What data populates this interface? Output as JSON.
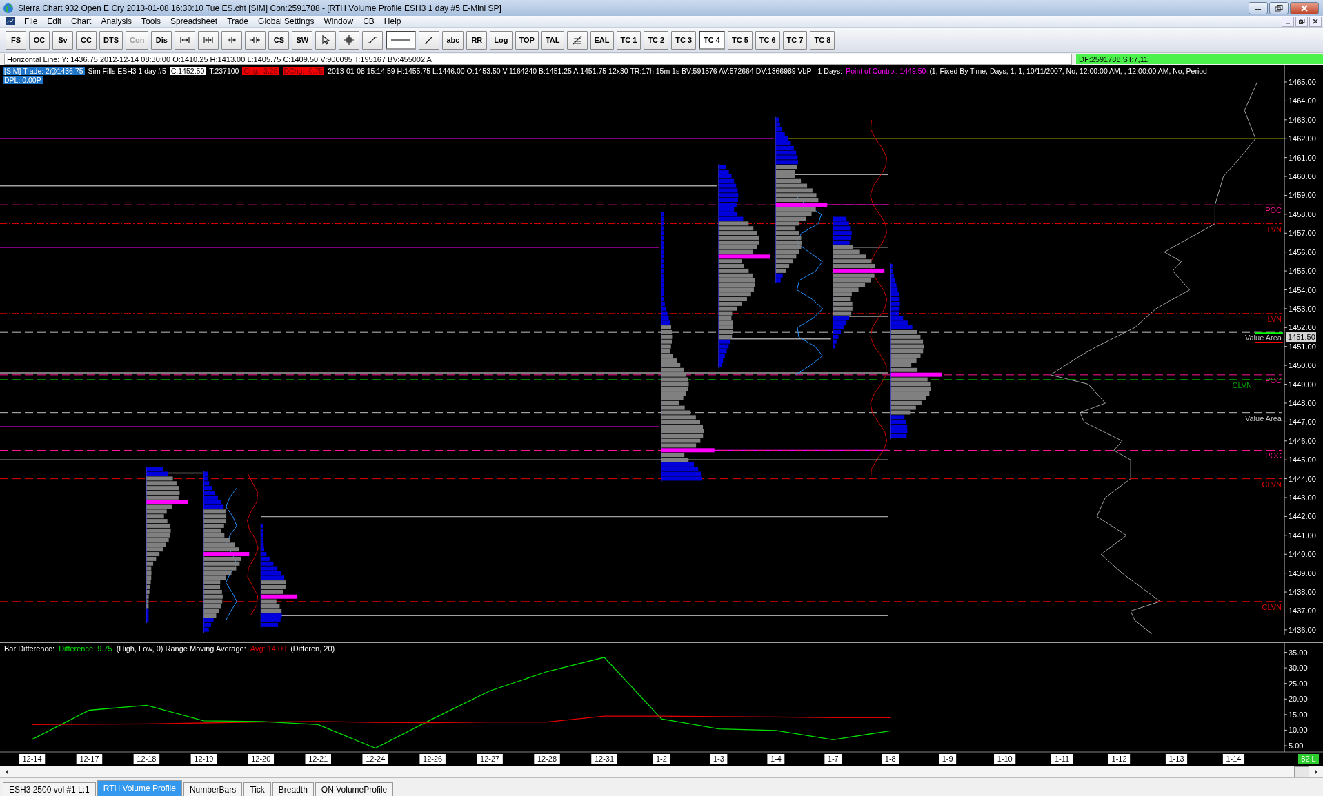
{
  "window": {
    "title": "Sierra Chart 932 Open E Cry 2013-01-08  16:30:10 Tue  ES.cht [SIM] Con:2591788 - [RTH Volume Profile  ESH3  1 day  #5  E-Mini SP]"
  },
  "menu": [
    "File",
    "Edit",
    "Chart",
    "Analysis",
    "Tools",
    "Spreadsheet",
    "Trade",
    "Global Settings",
    "Window",
    "CB",
    "Help"
  ],
  "toolbar": [
    {
      "kind": "text",
      "label": "FS",
      "selected": false,
      "disabled": false
    },
    {
      "kind": "text",
      "label": "OC",
      "selected": false,
      "disabled": false
    },
    {
      "kind": "text",
      "label": "Sv",
      "selected": false,
      "disabled": false
    },
    {
      "kind": "text",
      "label": "CC",
      "selected": false,
      "disabled": false
    },
    {
      "kind": "text",
      "label": "DTS",
      "selected": false,
      "disabled": false
    },
    {
      "kind": "text",
      "label": "Con",
      "selected": false,
      "disabled": true
    },
    {
      "kind": "text",
      "label": "Dis",
      "selected": false,
      "disabled": false
    },
    {
      "kind": "icon",
      "selected": false,
      "disabled": false
    },
    {
      "kind": "icon",
      "selected": false,
      "disabled": false
    },
    {
      "kind": "icon",
      "selected": false,
      "disabled": false
    },
    {
      "kind": "icon",
      "selected": false,
      "disabled": false
    },
    {
      "kind": "text",
      "label": "CS",
      "selected": false,
      "disabled": false
    },
    {
      "kind": "text",
      "label": "SW",
      "selected": false,
      "disabled": false
    },
    {
      "kind": "icon",
      "selected": false,
      "disabled": false
    },
    {
      "kind": "icon",
      "selected": false,
      "disabled": false
    },
    {
      "kind": "icon",
      "selected": false,
      "disabled": false
    },
    {
      "kind": "icon",
      "selected": true,
      "disabled": false
    },
    {
      "kind": "icon",
      "selected": false,
      "disabled": false
    },
    {
      "kind": "text",
      "label": "abc",
      "selected": false,
      "disabled": false
    },
    {
      "kind": "text",
      "label": "RR",
      "selected": false,
      "disabled": false
    },
    {
      "kind": "text",
      "label": "Log",
      "selected": false,
      "disabled": false
    },
    {
      "kind": "text",
      "label": "TOP",
      "selected": false,
      "disabled": false
    },
    {
      "kind": "text",
      "label": "TAL",
      "selected": false,
      "disabled": false
    },
    {
      "kind": "icon",
      "selected": false,
      "disabled": false
    },
    {
      "kind": "text",
      "label": "EAL",
      "selected": false,
      "disabled": false
    },
    {
      "kind": "text",
      "label": "TC 1",
      "selected": false,
      "disabled": false
    },
    {
      "kind": "text",
      "label": "TC 2",
      "selected": false,
      "disabled": false
    },
    {
      "kind": "text",
      "label": "TC 3",
      "selected": false,
      "disabled": false
    },
    {
      "kind": "text",
      "label": "TC 4",
      "selected": true,
      "disabled": false
    },
    {
      "kind": "text",
      "label": "TC 5",
      "selected": false,
      "disabled": false
    },
    {
      "kind": "text",
      "label": "TC 6",
      "selected": false,
      "disabled": false
    },
    {
      "kind": "text",
      "label": "TC 7",
      "selected": false,
      "disabled": false
    },
    {
      "kind": "text",
      "label": "TC 8",
      "selected": false,
      "disabled": false
    }
  ],
  "info_bar": {
    "text": "Horizontal Line: Y: 1436.75  2012-12-14  08:30:00  O:1410.25  H:1413.00  L:1405.75  C:1409.50  V:900095  T:195167  BV:455002  A",
    "status": "DF:2591788  ST:7,11"
  },
  "chart_header": [
    [
      {
        "kind": "blue",
        "text": "[SIM]  Trade: 2@1436.75"
      },
      {
        "kind": "plain",
        "text": "Sim Fills  ESH3  1 day  #5"
      },
      {
        "kind": "box",
        "text": "C:1452.50"
      },
      {
        "kind": "plain",
        "text": "T:237100"
      },
      {
        "kind": "red",
        "text": "Chg: -3.25"
      },
      {
        "kind": "red",
        "text": "DChg: -0.75"
      },
      {
        "kind": "plain",
        "text": "2013-01-08 15:14:59 H:1455.75 L:1446.00 O:1453.50 V:1164240 B:1451.25 A:1451.75 12x30 TR:17h 15m 1s BV:591576 AV:572664 DV:1366989  VbP - 1 Days:"
      },
      {
        "kind": "magenta",
        "text": "Point of Control: 1449.50"
      },
      {
        "kind": "plain",
        "text": "(1, Fixed By Time, Days, 1, 1, 10/11/2007, No, 12:00:00 AM, , 12:00:00 AM, No, Period"
      }
    ],
    [
      {
        "kind": "blue",
        "text": "DPL: 0.00P"
      }
    ]
  ],
  "levels": [
    {
      "label": "POC",
      "color": "#ff1493",
      "kind": "dashed"
    },
    {
      "label": "LVN",
      "color": "#e00000",
      "kind": "dashdot"
    },
    {
      "label": "LVN",
      "color": "#e00000",
      "kind": "dashdot"
    },
    {
      "label": "Value Area",
      "color": "#c0c0c0",
      "kind": "dashed"
    },
    {
      "label": "POC",
      "color": "#ff1493",
      "kind": "dashed"
    },
    {
      "label": "CLVN",
      "color": "#00a000",
      "kind": "dashed"
    },
    {
      "label": "Value Area",
      "color": "#c0c0c0",
      "kind": "dashed"
    },
    {
      "label": "POC",
      "color": "#ff1493",
      "kind": "dashed"
    },
    {
      "label": "CLVN",
      "color": "#e00000",
      "kind": "dashed"
    },
    {
      "label": "CLVN",
      "color": "#e00000",
      "kind": "dashed"
    }
  ],
  "price_axis": {
    "labels": [
      "1465.00",
      "1464.00",
      "1463.00",
      "1462.00",
      "1461.00",
      "1460.00",
      "1459.00",
      "1458.00",
      "1457.00",
      "1456.00",
      "1455.00",
      "1454.00",
      "1453.00",
      "1452.00",
      "1451.00",
      "1450.00",
      "1449.00",
      "1448.00",
      "1447.00",
      "1446.00",
      "1445.00",
      "1444.00",
      "1443.00",
      "1442.00",
      "1441.00",
      "1440.00",
      "1439.00",
      "1438.00",
      "1437.00",
      "1436.00"
    ],
    "current": "1451.50"
  },
  "lower_panel": {
    "legend": [
      {
        "kind": "plain",
        "text": "Bar Difference:"
      },
      {
        "kind": "series",
        "text": ": 9.75"
      },
      {
        "kind": "plain",
        "text": "(High, Low, 0)  Range Moving Average:"
      },
      {
        "kind": "series",
        "text": ": 14.00"
      },
      {
        "kind": "plain",
        "text": "(Differen, 20)"
      }
    ],
    "chart_data": {
      "type": "line",
      "categories": [
        "12-14",
        "12-17",
        "12-18",
        "12-19",
        "12-20",
        "12-21",
        "12-24",
        "12-26",
        "12-27",
        "12-28",
        "12-31",
        "1-2",
        "1-3",
        "1-4",
        "1-7",
        "1-8",
        "1-9",
        "1-10",
        "1-11",
        "1-12",
        "1-13",
        "1-14"
      ],
      "series": [
        {
          "name": "Difference",
          "color": "#00e000",
          "values": [
            7,
            16.4,
            18,
            13,
            12.8,
            11.8,
            4.2,
            13.6,
            22.6,
            28.8,
            33.4,
            13.6,
            10.4,
            9.9,
            6.9,
            9.8,
            null,
            null,
            null,
            null,
            null,
            null
          ]
        },
        {
          "name": "Avg",
          "color": "#e00000",
          "values": [
            11.8,
            11.9,
            12,
            12.3,
            12.6,
            12.8,
            12.5,
            12.4,
            12.6,
            12.6,
            14.5,
            14.5,
            14.3,
            14.2,
            14,
            14,
            null,
            null,
            null,
            null,
            null,
            null
          ]
        }
      ],
      "ylim": [
        3,
        38
      ],
      "yticks": [
        {
          "value": 35,
          "label": "35.00"
        },
        {
          "value": 30,
          "label": "30.00"
        },
        {
          "value": 25,
          "label": "25.00"
        },
        {
          "value": 20,
          "label": "20.00"
        },
        {
          "value": 15,
          "label": "15.00"
        },
        {
          "value": 10,
          "label": "10.00"
        },
        {
          "value": 5,
          "label": "5.00"
        }
      ]
    }
  },
  "bar_count": "82 L",
  "tabs": [
    {
      "label": "ESH3  2500 vol  #1  L:1",
      "selected": false
    },
    {
      "label": "RTH Volume Profile",
      "selected": true
    },
    {
      "label": "NumberBars",
      "selected": false
    },
    {
      "label": "Tick",
      "selected": false
    },
    {
      "label": "Breadth",
      "selected": false
    },
    {
      "label": "ON VolumeProfile",
      "selected": false
    }
  ]
}
